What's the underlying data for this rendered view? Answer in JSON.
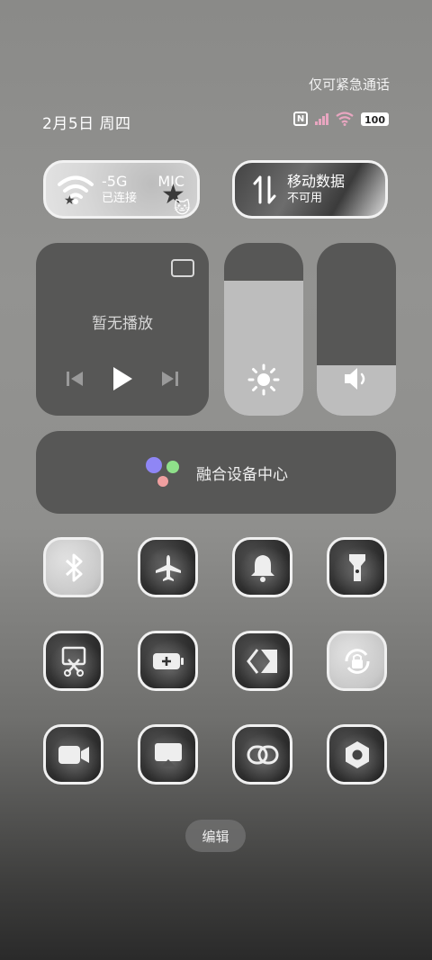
{
  "status_bar": {
    "emergency_text": "仅可紧急通话",
    "date": "2月5日 周四",
    "nfc_label": "N",
    "battery": "100"
  },
  "top_tiles": {
    "wifi": {
      "name": "-5G",
      "name_suffix": "MIC",
      "status": "已连接",
      "icon": "wifi-icon"
    },
    "mobile_data": {
      "name": "移动数据",
      "status": "不可用",
      "icon": "data-arrows-icon"
    }
  },
  "media": {
    "title": "暂无播放",
    "icons": [
      "cast-icon",
      "previous-icon",
      "play-icon",
      "next-icon"
    ]
  },
  "brightness": {
    "level": 0.78,
    "icon": "sun-icon"
  },
  "volume": {
    "level": 0.29,
    "icon": "speaker-icon"
  },
  "fusion": {
    "label": "融合设备中心",
    "colors": [
      "#8f86f5",
      "#8fe08a",
      "#f0a0a0"
    ]
  },
  "quick_tiles": [
    {
      "icon": "bluetooth-icon",
      "on": true
    },
    {
      "icon": "airplane-icon",
      "on": false
    },
    {
      "icon": "bell-icon",
      "on": false
    },
    {
      "icon": "flashlight-icon",
      "on": false
    },
    {
      "icon": "screenshot-icon",
      "on": false
    },
    {
      "icon": "battery-saver-icon",
      "on": false
    },
    {
      "icon": "nearby-share-icon",
      "on": false
    },
    {
      "icon": "rotation-lock-icon",
      "on": true
    },
    {
      "icon": "screen-record-icon",
      "on": false
    },
    {
      "icon": "screen-cast-icon",
      "on": false
    },
    {
      "icon": "link-icon",
      "on": false
    },
    {
      "icon": "settings-nut-icon",
      "on": false
    }
  ],
  "edit_label": "编辑"
}
